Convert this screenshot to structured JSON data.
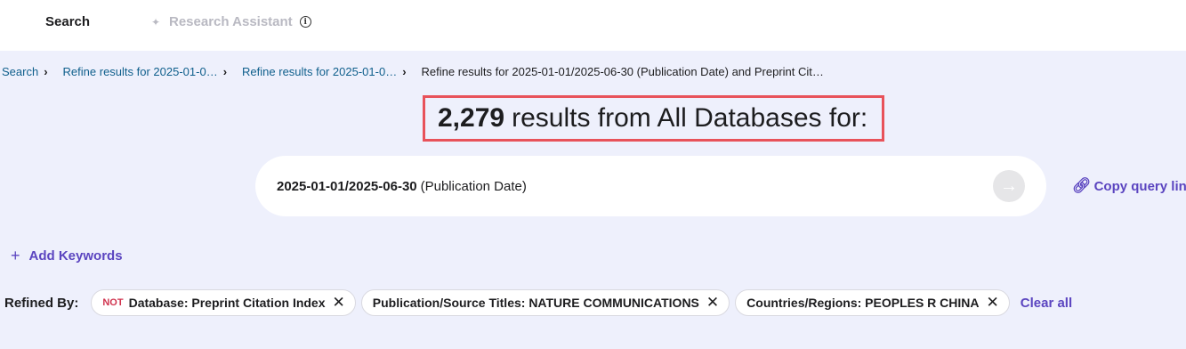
{
  "topbar": {
    "search_tab": "Search",
    "research_assistant_tab": "Research Assistant",
    "sparkle_icon": "sparkle-icon",
    "info_icon": "info-icon"
  },
  "breadcrumb": {
    "items": [
      "Search",
      "Refine results for 2025-01-0…",
      "Refine results for 2025-01-0…"
    ],
    "current": "Refine results for 2025-01-01/2025-06-30 (Publication Date) and Preprint Cit…"
  },
  "results": {
    "count": "2,279",
    "text": "results from All Databases for:"
  },
  "query": {
    "value": "2025-01-01/2025-06-30",
    "field": "(Publication Date)",
    "submit_icon": "arrow-right-icon"
  },
  "copy_query_link": {
    "label": "Copy query link",
    "icon": "link-icon"
  },
  "add_keywords": {
    "label": "Add Keywords"
  },
  "refined_by": {
    "label": "Refined By:",
    "chips": [
      {
        "prefix": "NOT",
        "text": "Database: Preprint Citation Index"
      },
      {
        "prefix": "",
        "text": "Publication/Source Titles: NATURE COMMUNICATIONS"
      },
      {
        "prefix": "",
        "text": "Countries/Regions: PEOPLES R CHINA"
      }
    ],
    "clear_all": "Clear all"
  },
  "colors": {
    "accent": "#5b45c0",
    "link": "#0f5f8c",
    "highlight_border": "#e8525a",
    "not_badge": "#d0334e",
    "background": "#eef0fc"
  }
}
